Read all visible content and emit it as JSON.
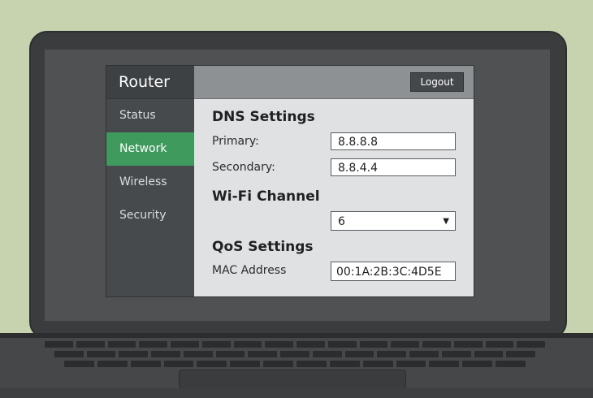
{
  "app": {
    "title": "Router"
  },
  "sidebar": {
    "items": [
      {
        "label": "Status"
      },
      {
        "label": "Network"
      },
      {
        "label": "Wireless"
      },
      {
        "label": "Security"
      }
    ],
    "active": "Network"
  },
  "topbar": {
    "logout_label": "Logout"
  },
  "dns": {
    "heading": "DNS Settings",
    "primary_label": "Primary:",
    "primary_value": "8.8.8.8",
    "secondary_label": "Secondary:",
    "secondary_value": "8.8.4.4"
  },
  "wifi": {
    "heading": "Wi-Fi Channel",
    "channel_value": "6"
  },
  "qos": {
    "heading": "QoS Settings",
    "mac_label": "MAC Address",
    "mac_value": "00:1A:2B:3C:4D5E"
  },
  "colors": {
    "accent": "#3f9b5d",
    "background": "#c7d3ae",
    "sidebar": "#474a4d"
  },
  "icons": {
    "dropdown": "caret-down-icon"
  }
}
